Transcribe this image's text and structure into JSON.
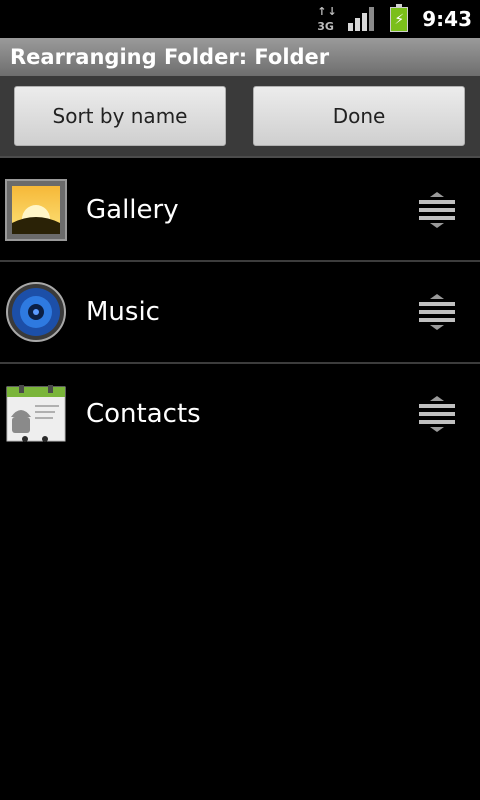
{
  "status_bar": {
    "network_type": "3G",
    "network_arrows": "↑↓",
    "time": "9:43",
    "icons": [
      "network-3g-icon",
      "signal-strength-icon",
      "battery-charging-icon"
    ]
  },
  "title_bar": {
    "title": "Rearranging Folder: Folder"
  },
  "buttons": {
    "sort_label": "Sort by name",
    "done_label": "Done"
  },
  "apps": [
    {
      "label": "Gallery",
      "icon": "gallery-icon"
    },
    {
      "label": "Music",
      "icon": "music-icon"
    },
    {
      "label": "Contacts",
      "icon": "contacts-icon"
    }
  ],
  "colors": {
    "background": "#000000",
    "title_bar": "#8a8a8a",
    "battery": "#7bbf1a"
  }
}
